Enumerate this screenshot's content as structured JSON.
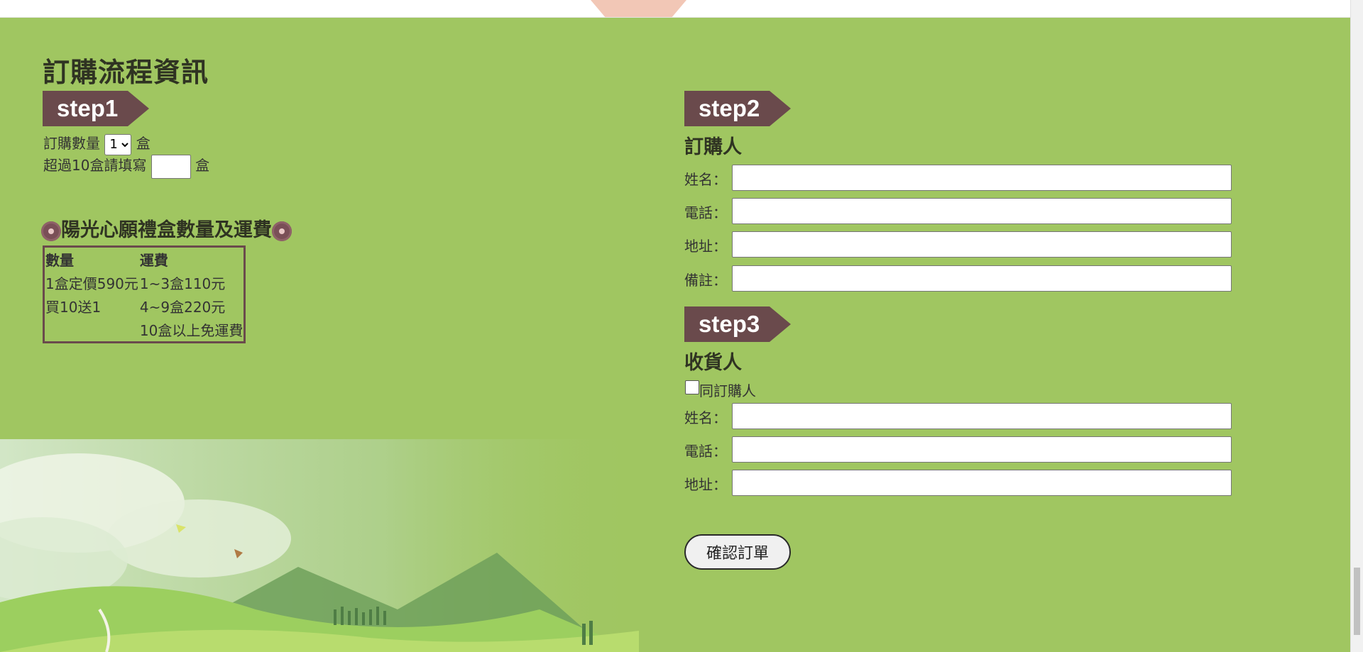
{
  "section_title": "訂購流程資訊",
  "step1": {
    "tag": "step1",
    "qty_label": "訂購數量",
    "qty_value": "1",
    "unit": "盒",
    "over_label": "超過10盒請填寫",
    "over_unit": "盒"
  },
  "price_box": {
    "title": "陽光心願禮盒數量及運費",
    "headers": [
      "數量",
      "運費"
    ],
    "rows": [
      [
        "1盒定價590元",
        "1~3盒110元"
      ],
      [
        "買10送1",
        "4~9盒220元"
      ],
      [
        "",
        "10盒以上免運費"
      ]
    ]
  },
  "step2": {
    "tag": "step2",
    "heading": "訂購人",
    "name_label": "姓名：",
    "phone_label": "電話：",
    "address_label": "地址：",
    "note_label": "備註："
  },
  "step3": {
    "tag": "step3",
    "heading": "收貨人",
    "same_label": "同訂購人",
    "name_label": "姓名：",
    "phone_label": "電話：",
    "address_label": "地址："
  },
  "confirm_button": "確認訂單",
  "colors": {
    "page_green": "#a0c661",
    "tag_brown": "#6a4a4c"
  }
}
